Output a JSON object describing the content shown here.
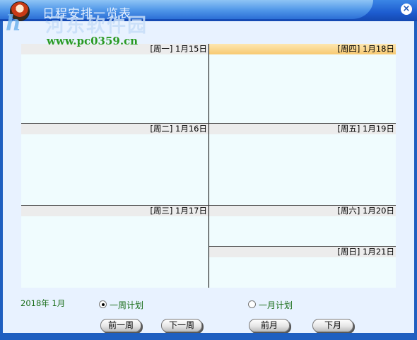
{
  "window": {
    "title": "日程安排一览表",
    "close_icon": "×"
  },
  "watermark": {
    "site_name": "河东软件园",
    "logo_glyph": "h",
    "url": "www.pc0359.cn"
  },
  "days": [
    {
      "label": "[周一] 1月15日",
      "active": false
    },
    {
      "label": "[周二] 1月16日",
      "active": false
    },
    {
      "label": "[周三] 1月17日",
      "active": false
    },
    {
      "label": "[周四] 1月18日",
      "active": true
    },
    {
      "label": "[周五] 1月19日",
      "active": false
    },
    {
      "label": "[周六] 1月20日",
      "active": false
    },
    {
      "label": "[周日] 1月21日",
      "active": false
    }
  ],
  "footer": {
    "year_month": "2018年 1月",
    "view_options": {
      "week": {
        "label": "一周计划",
        "selected": true
      },
      "month": {
        "label": "一月计划",
        "selected": false
      }
    },
    "buttons": {
      "prev_week": "前一周",
      "next_week": "下一周",
      "prev_month": "前月",
      "next_month": "下月"
    }
  },
  "colors": {
    "accent_title": "#2c6fd6",
    "active_day_header": "#f7c972",
    "panel_background": "#f0fcfe",
    "label_green": "#1b6e1b"
  }
}
